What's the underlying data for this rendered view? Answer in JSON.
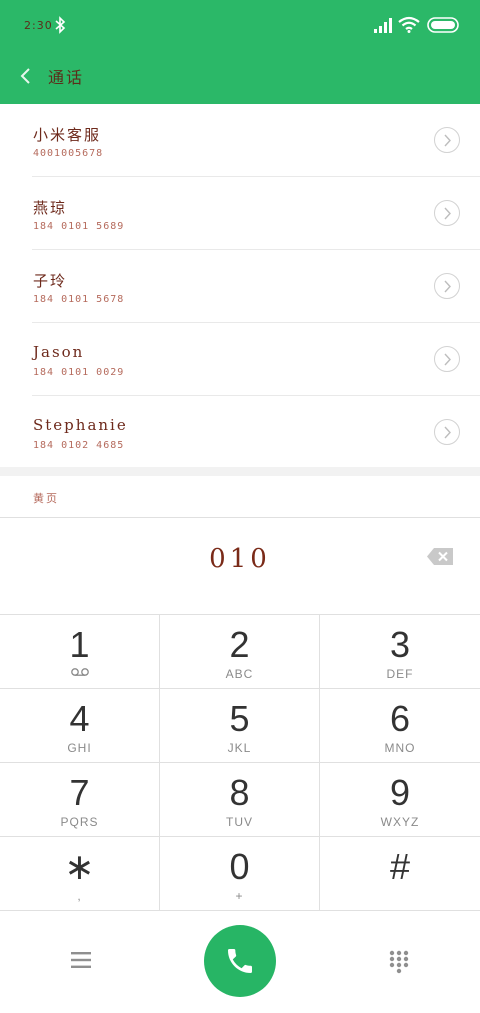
{
  "status": {
    "time": "2:30"
  },
  "header": {
    "title": "通话"
  },
  "contacts": [
    {
      "name": "小米客服",
      "number": "4001005678"
    },
    {
      "name": "燕琼",
      "number": "184 0101 5689"
    },
    {
      "name": "子玲",
      "number": "184 0101 5678"
    },
    {
      "name": "Jason",
      "number": "184 0101 0029"
    },
    {
      "name": "Stephanie",
      "number": "184 0102 4685"
    }
  ],
  "section": {
    "yellow_pages": "黄页"
  },
  "dialer": {
    "input": "010"
  },
  "keypad": [
    {
      "digit": "1",
      "letters": ""
    },
    {
      "digit": "2",
      "letters": "ABC"
    },
    {
      "digit": "3",
      "letters": "DEF"
    },
    {
      "digit": "4",
      "letters": "GHI"
    },
    {
      "digit": "5",
      "letters": "JKL"
    },
    {
      "digit": "6",
      "letters": "MNO"
    },
    {
      "digit": "7",
      "letters": "PQRS"
    },
    {
      "digit": "8",
      "letters": "TUV"
    },
    {
      "digit": "9",
      "letters": "WXYZ"
    },
    {
      "digit": "∗",
      "letters": ","
    },
    {
      "digit": "0",
      "letters": "+"
    },
    {
      "digit": "#",
      "letters": ""
    }
  ],
  "icons": {
    "back": "back-arrow-icon",
    "bluetooth": "bluetooth-icon",
    "signal": "signal-icon",
    "wifi": "wifi-icon",
    "battery": "battery-icon",
    "detail": "chevron-right-icon",
    "backspace": "backspace-icon",
    "voicemail": "voicemail-icon",
    "menu": "menu-icon",
    "call": "phone-icon",
    "dialpad": "dialpad-icon"
  },
  "colors": {
    "accent": "#2bb868",
    "call": "#27b565",
    "text_brown": "#6e2a1c"
  }
}
